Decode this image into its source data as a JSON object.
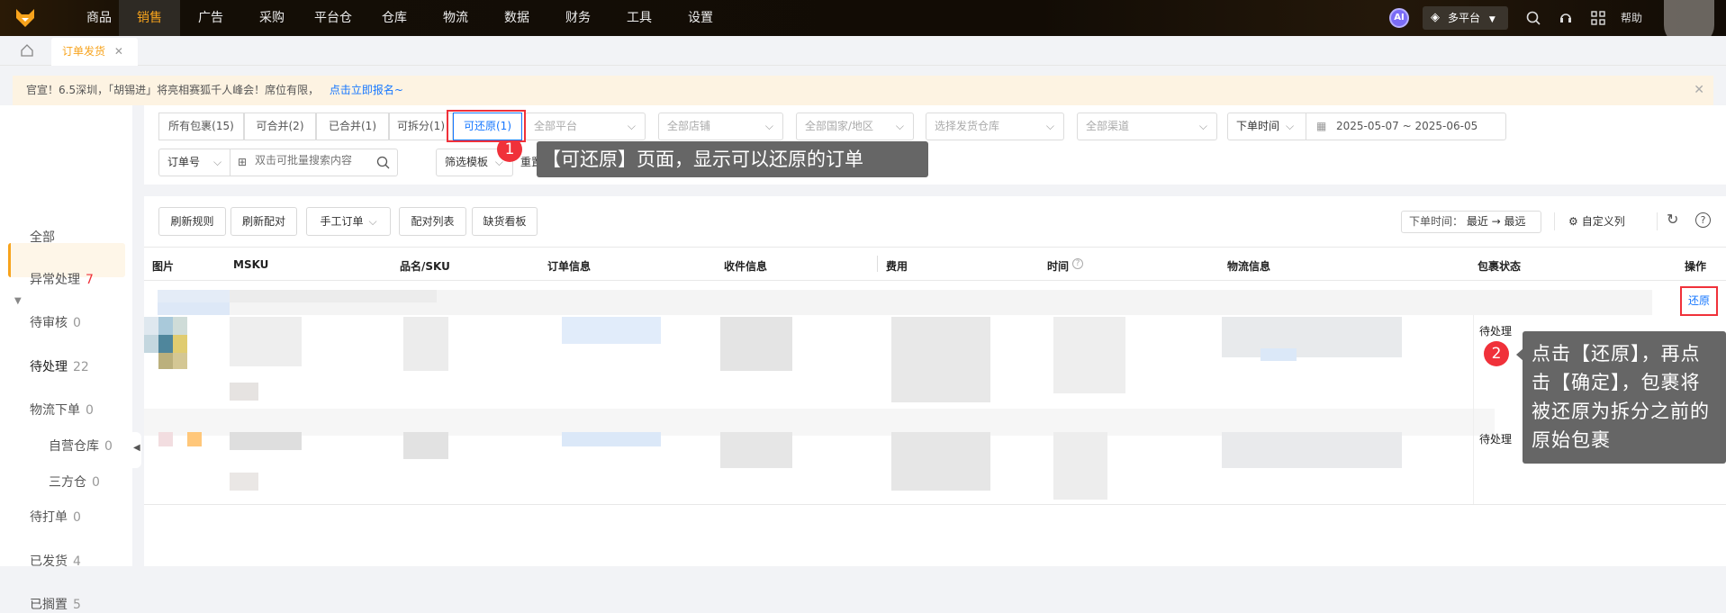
{
  "nav": {
    "items": [
      "商品",
      "销售",
      "广告",
      "采购",
      "平台仓",
      "仓库",
      "物流",
      "数据",
      "财务",
      "工具",
      "设置"
    ],
    "active": "销售",
    "ai_label": "AI",
    "platform_label": "多平台",
    "help_label": "帮助"
  },
  "tabs": {
    "items": [
      {
        "label": "订单发货"
      }
    ]
  },
  "banner": {
    "text": "官宣！6.5深圳，「胡锡进」将亮相赛狐千人峰会！席位有限，",
    "link": "点击立即报名~"
  },
  "sidebar": {
    "items": [
      {
        "label": "全部",
        "count": ""
      },
      {
        "label": "异常处理",
        "count": "7"
      },
      {
        "label": "待审核",
        "count": "0"
      },
      {
        "label": "待处理",
        "count": "22"
      },
      {
        "label": "物流下单",
        "count": "0"
      },
      {
        "label": "自营仓库",
        "count": "0"
      },
      {
        "label": "三方仓",
        "count": "0"
      },
      {
        "label": "待打单",
        "count": "0"
      },
      {
        "label": "已发货",
        "count": "4"
      },
      {
        "label": "已搁置",
        "count": "5"
      }
    ]
  },
  "filters": {
    "segments": [
      "所有包裹(15)",
      "可合并(2)",
      "已合并(1)",
      "可拆分(1)",
      "可还原(1)"
    ],
    "dropdowns": [
      "全部平台",
      "全部店铺",
      "全部国家/地区",
      "选择发货仓库",
      "全部渠道"
    ],
    "time_type": "下单时间",
    "date_start": "2025-05-07",
    "date_sep": "~",
    "date_end": "2025-06-05",
    "search_type": "订单号",
    "search_placeholder": "双击可批量搜索内容",
    "template": "筛选模板",
    "reset": "重置"
  },
  "toolbar": {
    "buttons": [
      "刷新规则",
      "刷新配对",
      "手工订单",
      "配对列表",
      "缺货看板"
    ],
    "sort_label": "下单时间：",
    "sort_value": "最近 → 最远",
    "custom_columns": "自定义列"
  },
  "table": {
    "headers": [
      "图片",
      "MSKU",
      "品名/SKU",
      "订单信息",
      "收件信息",
      "费用",
      "时间",
      "物流信息",
      "包裹状态",
      "操作"
    ],
    "rows": [
      {
        "status": "待处理",
        "action": "还原"
      },
      {
        "status": "待处理"
      }
    ]
  },
  "annotations": {
    "badge1": "1",
    "tip1": "【可还原】页面，显示可以还原的订单",
    "badge2": "2",
    "tip2": "点击【还原】，再点击【确定】，包裹将被还原为拆分之前的原始包裹"
  },
  "colors": {
    "accent": "#f7a31c",
    "link": "#1677ff",
    "highlight": "#f0313a"
  }
}
